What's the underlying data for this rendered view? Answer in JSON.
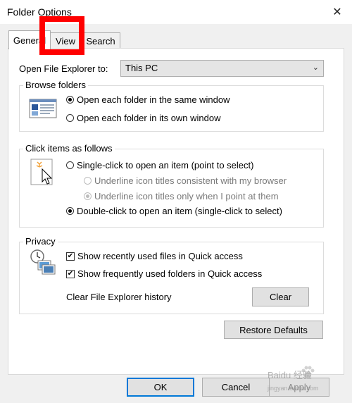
{
  "window": {
    "title": "Folder Options",
    "close_glyph": "✕"
  },
  "tabs": [
    {
      "label": "General"
    },
    {
      "label": "View"
    },
    {
      "label": "Search"
    }
  ],
  "open_explorer": {
    "label": "Open File Explorer to:",
    "value": "This PC"
  },
  "browse_folders": {
    "title": "Browse folders",
    "options": [
      {
        "label": "Open each folder in the same window",
        "selected": true
      },
      {
        "label": "Open each folder in its own window",
        "selected": false
      }
    ]
  },
  "click_items": {
    "title": "Click items as follows",
    "single_click": "Single-click to open an item (point to select)",
    "underline_consistent": "Underline icon titles consistent with my browser",
    "underline_point": "Underline icon titles only when I point at them",
    "double_click": "Double-click to open an item (single-click to select)"
  },
  "privacy": {
    "title": "Privacy",
    "show_recent_files": "Show recently used files in Quick access",
    "show_frequent_folders": "Show frequently used folders in Quick access",
    "clear_history_label": "Clear File Explorer history",
    "clear_button": "Clear"
  },
  "buttons": {
    "restore_defaults": "Restore Defaults",
    "ok": "OK",
    "cancel": "Cancel",
    "apply": "Apply"
  },
  "watermark": {
    "text": "Baidu 经验",
    "sub": "jingyan.baidu.com"
  },
  "colors": {
    "highlight_box": "#ff0000",
    "default_button_border": "#0078d7"
  }
}
